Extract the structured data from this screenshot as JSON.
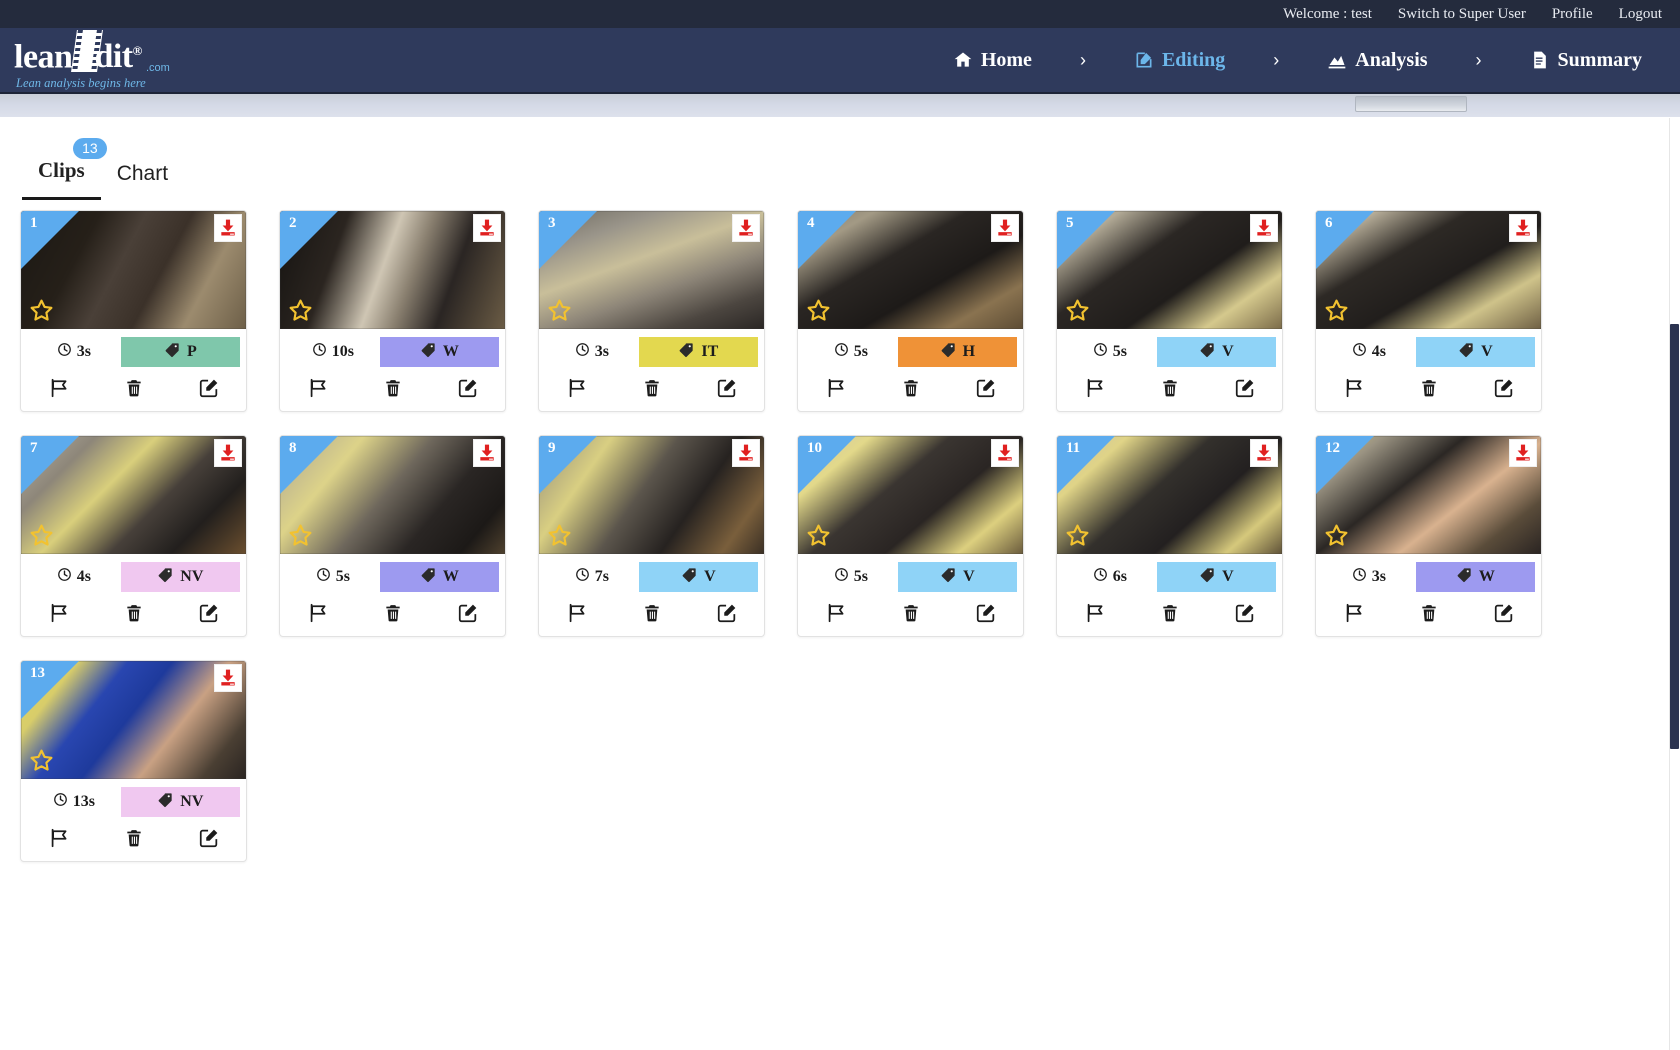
{
  "topbar": {
    "welcome": "Welcome : test",
    "switch_user": "Switch to Super User",
    "profile": "Profile",
    "logout": "Logout"
  },
  "brand": {
    "name_lean": "lean",
    "name_dit": "dit",
    "registered": "®",
    "dotcom": ".com",
    "tagline": "Lean analysis begins here"
  },
  "nav": {
    "items": [
      {
        "label": "Home",
        "icon": "home-icon",
        "active": false
      },
      {
        "label": "Editing",
        "icon": "edit-square-icon",
        "active": true
      },
      {
        "label": "Analysis",
        "icon": "chart-icon",
        "active": false
      },
      {
        "label": "Summary",
        "icon": "document-icon",
        "active": false
      }
    ],
    "separator": "›"
  },
  "tabs": [
    {
      "label": "Clips",
      "badge": "13",
      "active": true
    },
    {
      "label": "Chart",
      "badge": "",
      "active": false
    }
  ],
  "card_icons": {
    "download": "download-icon",
    "star": "star-icon",
    "clock": "clock-icon",
    "tag": "tag-icon",
    "flag": "flag-icon",
    "trash": "trash-icon",
    "edit": "edit-note-icon"
  },
  "tag_colors": {
    "P": "#7fc7ab",
    "W": "#9d9af0",
    "IT": "#e3d84f",
    "H": "#ef9237",
    "V": "#8fd3f7",
    "NV": "#f0c8f0"
  },
  "clips": [
    {
      "number": "1",
      "duration": "3s",
      "tag": "P",
      "color": "#7fc7ab",
      "photo": "kitchen-rack-worker"
    },
    {
      "number": "2",
      "duration": "10s",
      "tag": "W",
      "color": "#9d9af0",
      "photo": "worker-carrying-dough-tray"
    },
    {
      "number": "3",
      "duration": "3s",
      "tag": "IT",
      "color": "#e3d84f",
      "photo": "oven-conveyor-blur"
    },
    {
      "number": "4",
      "duration": "5s",
      "tag": "H",
      "color": "#ef9237",
      "photo": "worker-at-oven"
    },
    {
      "number": "5",
      "duration": "5s",
      "tag": "V",
      "color": "#8fd3f7",
      "photo": "worker-at-counter-dough"
    },
    {
      "number": "6",
      "duration": "4s",
      "tag": "V",
      "color": "#8fd3f7",
      "photo": "worker-back-at-counter"
    },
    {
      "number": "7",
      "duration": "4s",
      "tag": "NV",
      "color": "#f0c8f0",
      "photo": "counter-yellow-tray"
    },
    {
      "number": "8",
      "duration": "5s",
      "tag": "W",
      "color": "#9d9af0",
      "photo": "worker-side-counter"
    },
    {
      "number": "9",
      "duration": "7s",
      "tag": "V",
      "color": "#8fd3f7",
      "photo": "worker-moving-tray"
    },
    {
      "number": "10",
      "duration": "5s",
      "tag": "V",
      "color": "#8fd3f7",
      "photo": "worker-prepping-pizza"
    },
    {
      "number": "11",
      "duration": "6s",
      "tag": "V",
      "color": "#8fd3f7",
      "photo": "worker-at-prep-line"
    },
    {
      "number": "12",
      "duration": "3s",
      "tag": "W",
      "color": "#9d9af0",
      "photo": "worker-hand-reaching"
    },
    {
      "number": "13",
      "duration": "13s",
      "tag": "NV",
      "color": "#f0c8f0",
      "photo": "register-monitor-hand"
    }
  ]
}
